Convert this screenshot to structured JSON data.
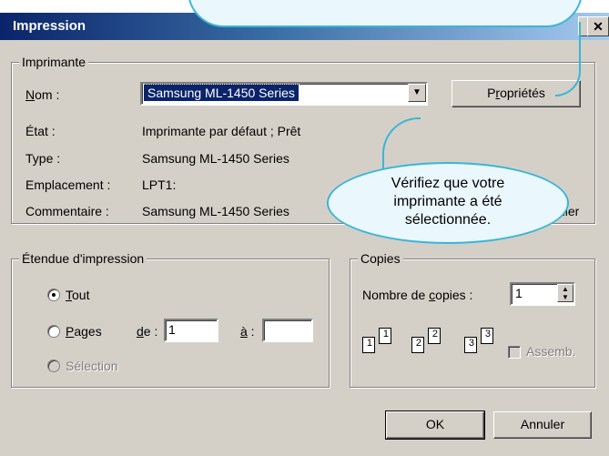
{
  "window": {
    "title": "Impression"
  },
  "printer_group": {
    "legend": "Imprimante",
    "name_label": "Nom :",
    "name_value": "Samsung ML-1450 Series",
    "properties_button": "Propriétés",
    "status_label": "État :",
    "status_value": "Imprimante par défaut ; Prêt",
    "type_label": "Type :",
    "type_value": "Samsung ML-1450 Series",
    "location_label": "Emplacement :",
    "location_value": "LPT1:",
    "comment_label": "Commentaire :",
    "comment_value": "Samsung ML-1450 Series",
    "print_to_file_partial": "chier"
  },
  "range_group": {
    "legend": "Étendue d'impression",
    "all_label": "Tout",
    "pages_label": "Pages",
    "from_label": "de :",
    "from_value": "1",
    "to_label": "à :",
    "to_value": "",
    "selection_label": "Sélection"
  },
  "copies_group": {
    "legend": "Copies",
    "count_label": "Nombre de copies :",
    "count_value": "1",
    "collate_label": "Assemb.",
    "collate_checked": false
  },
  "buttons": {
    "ok": "OK",
    "cancel": "Annuler"
  },
  "callout": {
    "text_line1": "Vérifiez que votre",
    "text_line2": "imprimante a été",
    "text_line3": "sélectionnée."
  },
  "colors": {
    "titlebar_start": "#0a246a",
    "titlebar_end": "#a6caf0",
    "dialog_bg": "#d4d0c8",
    "selection_bg": "#0a246a",
    "callout_border": "#3ab5d8",
    "callout_fill": "#eaf7fc"
  }
}
